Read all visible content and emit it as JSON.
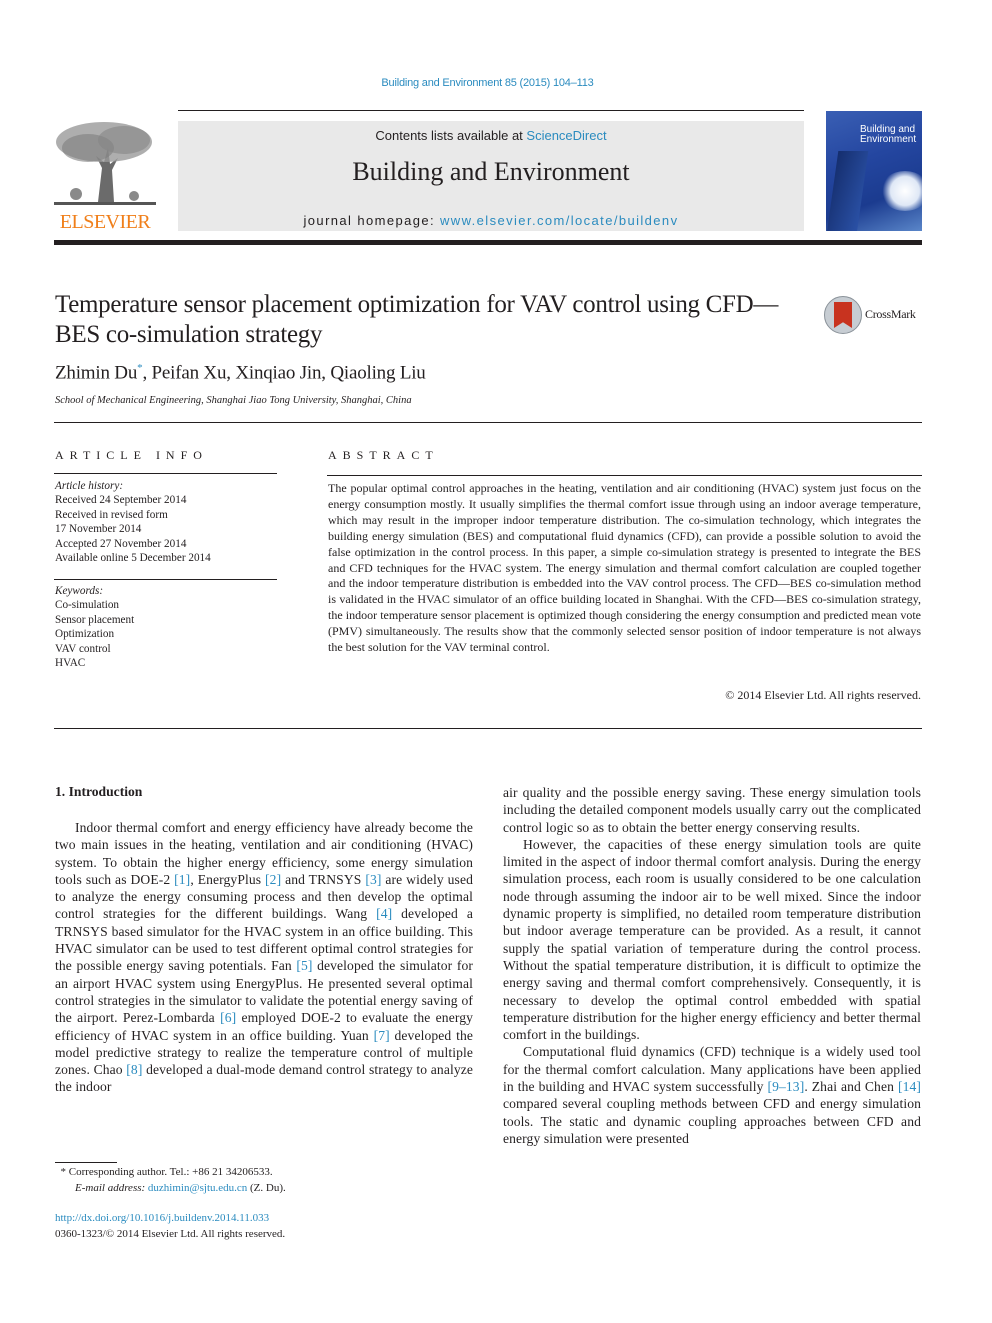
{
  "header": {
    "journal_ref": "Building and Environment 85 (2015) 104–113",
    "contents_prefix": "Contents lists available at ",
    "contents_link": "ScienceDirect",
    "journal_name": "Building and Environment",
    "homepage_prefix": "journal homepage: ",
    "homepage_link": "www.elsevier.com/locate/buildenv",
    "publisher_logo_text": "ELSEVIER",
    "cover_title_line1": "Building and",
    "cover_title_line2": "Environment",
    "colors": {
      "link": "#2a8bbf",
      "elsevier_orange": "#f07f1a",
      "masthead_bg": "#e9e9e9"
    }
  },
  "article": {
    "title": "Temperature sensor placement optimization for VAV control using CFD—BES co-simulation strategy",
    "crossmark_label": "CrossMark",
    "authors_first": "Zhimin Du",
    "authors_star": "*",
    "authors_rest": ", Peifan Xu, Xinqiao Jin, Qiaoling Liu",
    "affiliation": "School of Mechanical Engineering, Shanghai Jiao Tong University, Shanghai, China"
  },
  "article_info": {
    "heading": "ARTICLE INFO",
    "history_label": "Article history:",
    "history": [
      "Received 24 September 2014",
      "Received in revised form",
      "17 November 2014",
      "Accepted 27 November 2014",
      "Available online 5 December 2014"
    ],
    "keywords_label": "Keywords:",
    "keywords": [
      "Co-simulation",
      "Sensor placement",
      "Optimization",
      "VAV control",
      "HVAC"
    ]
  },
  "abstract": {
    "heading": "ABSTRACT",
    "text": "The popular optimal control approaches in the heating, ventilation and air conditioning (HVAC) system just focus on the energy consumption mostly. It usually simplifies the thermal comfort issue through using an indoor average temperature, which may result in the improper indoor temperature distribution. The co-simulation technology, which integrates the building energy simulation (BES) and computational fluid dynamics (CFD), can provide a possible solution to avoid the false optimization in the control process. In this paper, a simple co-simulation strategy is presented to integrate the BES and CFD techniques for the HVAC system. The energy simulation and thermal comfort calculation are coupled together and the indoor temperature distribution is embedded into the VAV control process. The CFD—BES co-simulation method is validated in the HVAC simulator of an office building located in Shanghai. With the CFD—BES co-simulation strategy, the indoor temperature sensor placement is optimized though considering the energy consumption and predicted mean vote (PMV) simultaneously. The results show that the commonly selected sensor position of indoor temperature is not always the best solution for the VAV terminal control.",
    "copyright": "© 2014 Elsevier Ltd. All rights reserved."
  },
  "body": {
    "section_heading": "1.  Introduction",
    "left": {
      "p1_a": "Indoor thermal comfort and energy efficiency have already become the two main issues in the heating, ventilation and air conditioning (HVAC) system. To obtain the higher energy efficiency, some energy simulation tools such as DOE-2 ",
      "ref1": "[1]",
      "p1_b": ", EnergyPlus ",
      "ref2": "[2]",
      "p1_c": " and TRNSYS ",
      "ref3": "[3]",
      "p1_d": " are widely used to analyze the energy consuming process and then develop the optimal control strategies for the different buildings. Wang ",
      "ref4": "[4]",
      "p1_e": " developed a TRNSYS based simulator for the HVAC system in an office building. This HVAC simulator can be used to test different optimal control strategies for the possible energy saving potentials. Fan ",
      "ref5": "[5]",
      "p1_f": " developed the simulator for an airport HVAC system using EnergyPlus. He presented several optimal control strategies in the simulator to validate the potential energy saving of the airport. Perez-Lombarda ",
      "ref6": "[6]",
      "p1_g": " employed DOE-2 to evaluate the energy efficiency of HVAC system in an office building. Yuan ",
      "ref7": "[7]",
      "p1_h": " developed the model predictive strategy to realize the temperature control of multiple zones. Chao ",
      "ref8": "[8]",
      "p1_i": " developed a dual-mode demand control strategy to analyze the indoor"
    },
    "right": {
      "p1_cont": "air quality and the possible energy saving. These energy simulation tools including the detailed component models usually carry out the complicated control logic so as to obtain the better energy conserving results.",
      "p2": "However, the capacities of these energy simulation tools are quite limited in the aspect of indoor thermal comfort analysis. During the energy simulation process, each room is usually considered to be one calculation node through assuming the indoor air to be well mixed. Since the indoor dynamic property is simplified, no detailed room temperature distribution but indoor average temperature can be provided. As a result, it cannot supply the spatial variation of temperature during the control process. Without the spatial temperature distribution, it is difficult to optimize the energy saving and thermal comfort comprehensively. Consequently, it is necessary to develop the optimal control embedded with spatial temperature distribution for the higher energy efficiency and better thermal comfort in the buildings.",
      "p3_a": "Computational fluid dynamics (CFD) technique is a widely used tool for the thermal comfort calculation. Many applications have been applied in the building and HVAC system successfully ",
      "ref9": "[9–13]",
      "p3_b": ". Zhai and Chen ",
      "ref14": "[14]",
      "p3_c": " compared several coupling methods between CFD and energy simulation tools. The static and dynamic coupling approaches between CFD and energy simulation were presented"
    }
  },
  "footer": {
    "footnote_star": "*",
    "footnote_text": " Corresponding author. Tel.: +86 21 34206533.",
    "email_label": "E-mail address: ",
    "email": "duzhimin@sjtu.edu.cn",
    "email_suffix": " (Z. Du).",
    "doi": "http://dx.doi.org/10.1016/j.buildenv.2014.11.033",
    "issn_copyright": "0360-1323/© 2014 Elsevier Ltd. All rights reserved."
  }
}
